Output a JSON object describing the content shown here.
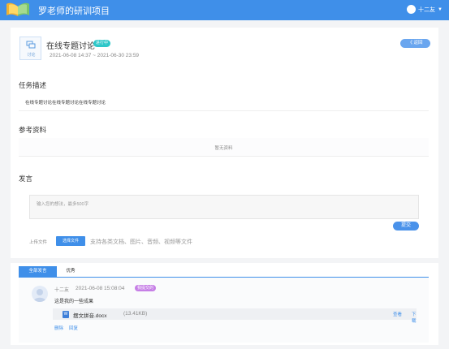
{
  "header": {
    "title": "罗老师的研训项目",
    "user_name": "十二友",
    "logo_icon": "book-logo-icon"
  },
  "task": {
    "icon_label": "讨论",
    "title": "在线专题讨论",
    "status": "进行中",
    "time_range": "2021-06-08 14:37 ~ 2021-06-30 23:59",
    "back_label": "《 返回"
  },
  "description": {
    "heading": "任务描述",
    "text": "在线专题讨论在线专题讨论在线专题讨论"
  },
  "references": {
    "heading": "参考资料",
    "empty_text": "暂无资料"
  },
  "speak": {
    "heading": "发言",
    "placeholder": "输入您的想法，最多500字",
    "submit_label": "提交",
    "upload_label": "上传文件",
    "choose_file_label": "选择文件",
    "upload_hint": "支持各类文档、图片、音频、视频等文件"
  },
  "tabs": [
    {
      "label": "全部发言",
      "active": true
    },
    {
      "label": "优秀",
      "active": false
    }
  ],
  "posts": [
    {
      "author": "十二友",
      "time": "2021-06-08 15:08:04",
      "badge": "我提交的",
      "content": "这是我的一些成果",
      "file": {
        "icon": "W",
        "name": "摆文拼音.docx",
        "size": "(13.41KB)",
        "view_label": "查看",
        "download_label": "下载"
      },
      "delete_label": "删除",
      "reply_label": "回复"
    }
  ],
  "colors": {
    "primary": "#3f8fe9",
    "status_badge": "#2ec7c9",
    "my_submit_badge": "#c67fe6"
  }
}
